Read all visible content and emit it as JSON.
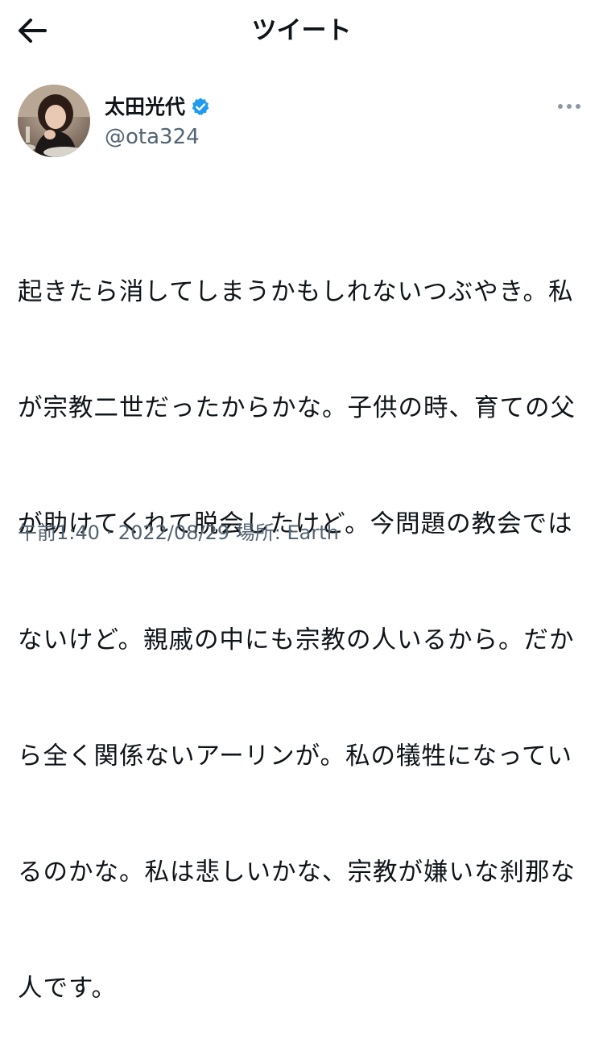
{
  "header": {
    "title": "ツイート",
    "back_icon": "arrow-left-icon"
  },
  "author": {
    "display_name": "太田光代",
    "handle": "@ota324",
    "verified": true,
    "verified_color": "#1d9bf0",
    "more_icon": "more-dots-icon"
  },
  "tweet": {
    "lines": [
      "起きたら消してしまうかもしれないつぶやき。私",
      "が宗教二世だったからかな。子供の時、育ての父",
      "が助けてくれて脱会したけど。今問題の教会では",
      "ないけど。親戚の中にも宗教の人いるから。だか",
      "ら全く関係ないアーリンが。私の犠牲になってい",
      "るのかな。私は悲しいかな、宗教が嫌いな刹那な",
      "人です。"
    ]
  },
  "meta": {
    "time": "午前1:40",
    "separator": " · ",
    "date": "2022/08/29",
    "location": " 場所: Earth"
  }
}
